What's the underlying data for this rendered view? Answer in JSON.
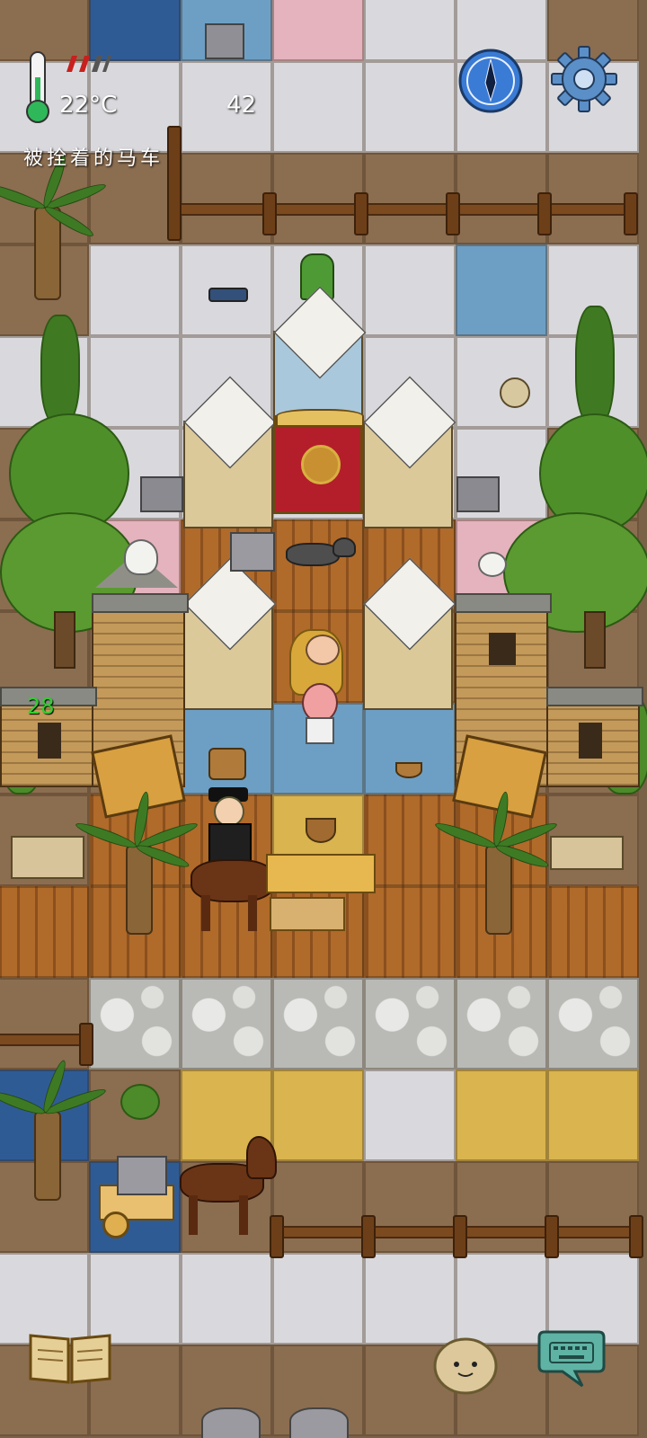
{
  "hud": {
    "temperature": "22°C",
    "food_count": "42",
    "location_label": "被拴着的马车",
    "green_number": "28",
    "health_pips": 3
  },
  "icons": {
    "thermometer": "thermometer-icon",
    "compass": "compass-icon",
    "settings": "gear-icon",
    "journal": "book-icon",
    "emote": "face-icon",
    "chat": "keyboard-chat-icon"
  },
  "colors": {
    "health": "#c8201e",
    "green_text": "#2fd12f",
    "compass": "#3a7bd5"
  }
}
